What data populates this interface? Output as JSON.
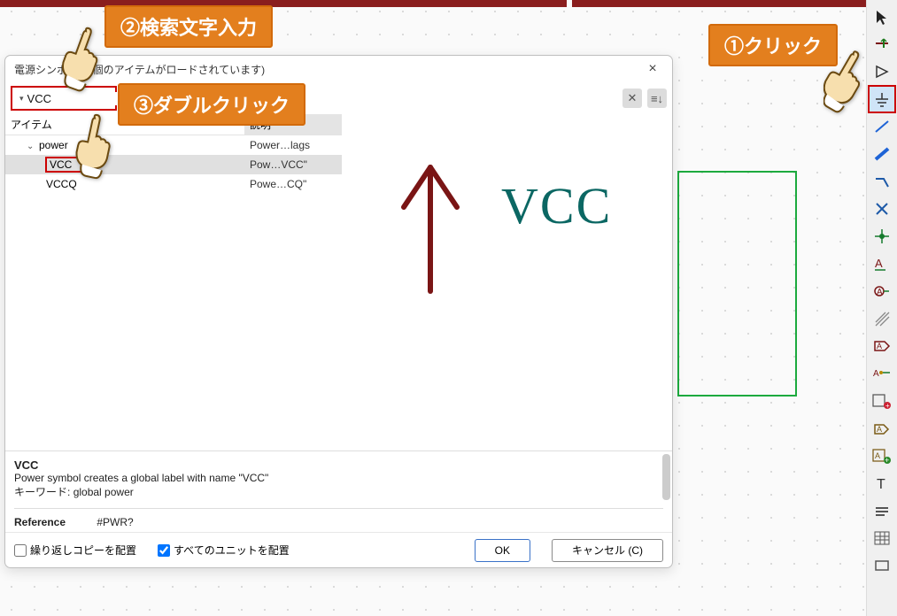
{
  "callouts": {
    "click": "①クリック",
    "search": "②検索文字入力",
    "dbl": "③ダブルクリック"
  },
  "dialog": {
    "title": "電源シンボル             06個のアイテムがロードされています)",
    "close_label": "×"
  },
  "search": {
    "value": "VCC",
    "placeholder": ""
  },
  "tree": {
    "header_item": "アイテム",
    "header_desc": "説明",
    "rows": [
      {
        "name": "power",
        "desc": "Power…lags"
      },
      {
        "name": "VCC",
        "desc": "Pow…VCC\""
      },
      {
        "name": "VCCQ",
        "desc": "Powe…CQ\""
      }
    ]
  },
  "preview": {
    "symbol_name": "VCC"
  },
  "details": {
    "symbol": "VCC",
    "desc": "Power symbol creates a global label with name \"VCC\"",
    "keywords_label": "キーワード:",
    "keywords_value": "global power",
    "ref_label": "Reference",
    "ref_value": "#PWR?"
  },
  "footer": {
    "repeat_copy": "繰り返しコピーを配置",
    "repeat_copy_checked": false,
    "all_units": "すべてのユニットを配置",
    "all_units_checked": true,
    "ok": "OK",
    "cancel": "キャンセル (C)"
  },
  "rtoolbar": [
    "cursor-icon",
    "probe-icon",
    "buffer-icon",
    "power-icon",
    "wire-icon",
    "bus-icon",
    "busentry-icon",
    "noconnect-icon",
    "junction-icon",
    "label-icon",
    "globallabel-icon",
    "hatch-icon",
    "netlabel-icon",
    "hierlabel-icon",
    "ercmarker-icon",
    "sheet-icon",
    "image-icon",
    "text-icon",
    "line-icon",
    "table-icon",
    "rect-icon"
  ],
  "rtoolbar_active_index": 3
}
